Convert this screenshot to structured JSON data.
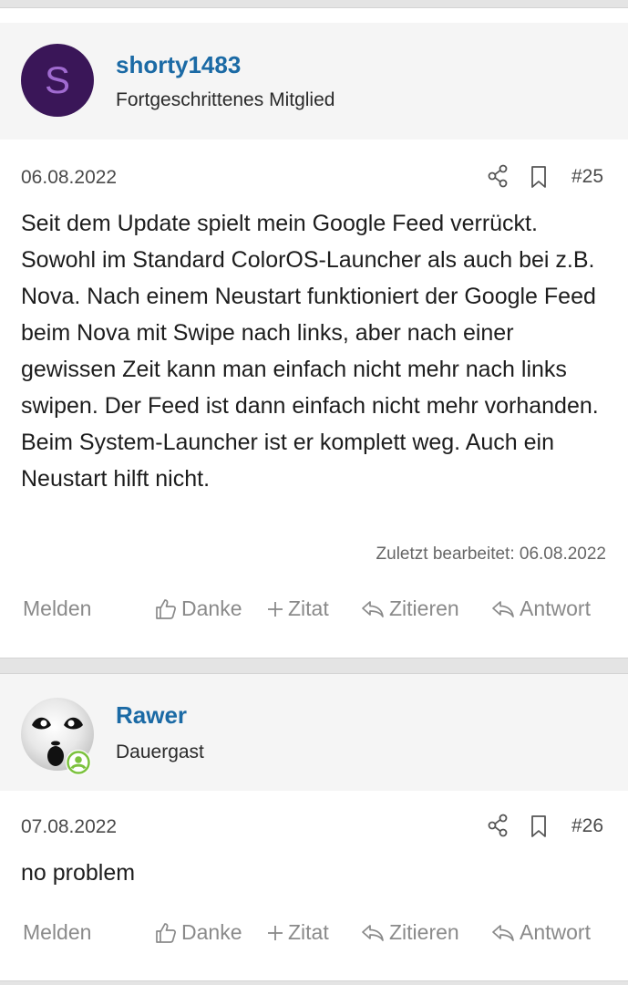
{
  "posts": [
    {
      "username": "shorty1483",
      "avatar_letter": "S",
      "user_title": "Fortgeschrittenes Mitglied",
      "date": "06.08.2022",
      "post_number": "#25",
      "body": "Seit dem Update spielt mein Google Feed verrückt. Sowohl im Standard ColorOS-Launcher als auch bei z.B. Nova. Nach einem Neustart funktioniert der Google Feed beim Nova mit Swipe nach links, aber nach einer gewissen Zeit kann man einfach nicht mehr nach links swipen. Der Feed ist dann einfach nicht mehr vorhanden. Beim System-Launcher ist er komplett weg. Auch ein Neustart hilft nicht.",
      "edited": "Zuletzt bearbeitet: 06.08.2022"
    },
    {
      "username": "Rawer",
      "user_title": "Dauergast",
      "date": "07.08.2022",
      "post_number": "#26",
      "body": "no problem"
    }
  ],
  "actions": {
    "report": "Melden",
    "like": "Danke",
    "quote": "Zitat",
    "cite": "Zitieren",
    "reply": "Antwort"
  },
  "colors": {
    "username": "#1b6aa5",
    "avatar_bg": "#3a1658",
    "online_badge": "#7cc23e"
  }
}
